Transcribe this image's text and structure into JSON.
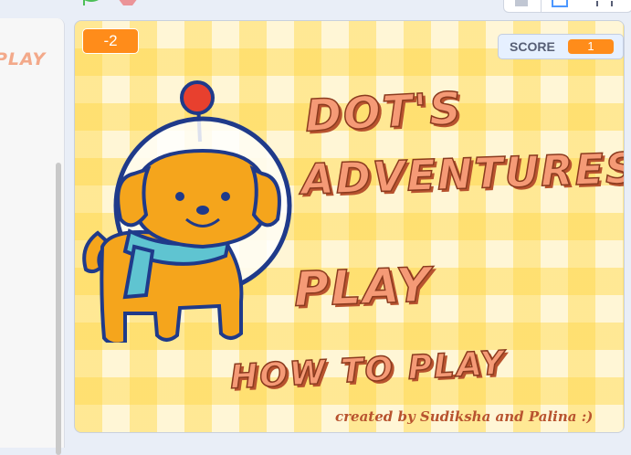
{
  "editor": {
    "sprite_costume_text": "PLAY"
  },
  "toolbar": {
    "green_flag_icon": "green-flag-icon",
    "stop_icon": "stop-icon",
    "small_stage_icon": "small-stage-icon",
    "normal_stage_icon": "normal-stage-icon",
    "fullscreen_icon": "fullscreen-icon"
  },
  "stage": {
    "variable_monitor_value": "-2",
    "score_label": "SCORE",
    "score_value": "1",
    "title_line1": "DOT'S",
    "title_line2": "ADVENTURES",
    "play_label": "PLAY",
    "how_to_play_label": "HOW TO PLAY",
    "credits": "created by Sudiksha and Palina :)"
  },
  "colors": {
    "monitor_orange": "#ff8c1a",
    "title_fill": "#f59a76",
    "title_shadow": "#b8532f",
    "dog_body": "#f5a51c",
    "dog_outline": "#1f3a8a",
    "scarf": "#5fc4d1",
    "antenna_ball": "#e8402e",
    "gingham_yellow": "#ffd746"
  }
}
